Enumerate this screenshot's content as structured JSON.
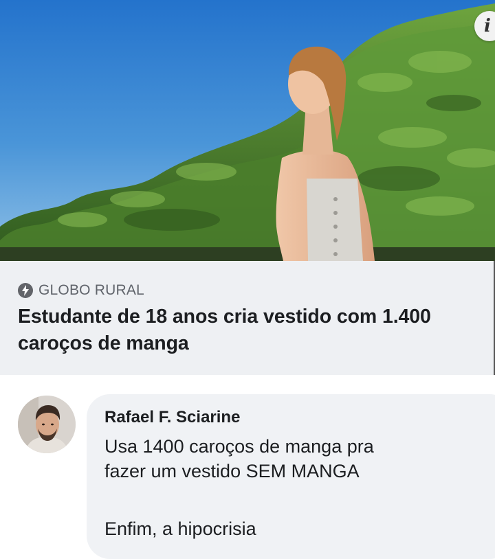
{
  "post": {
    "info_badge": "i",
    "source": "GLOBO RURAL",
    "headline": "Estudante de 18 anos cria vestido com 1.400 caroços de manga"
  },
  "comment": {
    "author": "Rafael F. Sciarine",
    "lines": [
      "Usa 1400 caroços de manga pra",
      "fazer um vestido SEM MANGA",
      "Enfim, a hipocrisia"
    ]
  },
  "colors": {
    "sky": "#2c7fd1",
    "foliage": "#3e7a2c",
    "meta_background": "#eef0f3",
    "bubble_background": "#f0f2f5"
  }
}
